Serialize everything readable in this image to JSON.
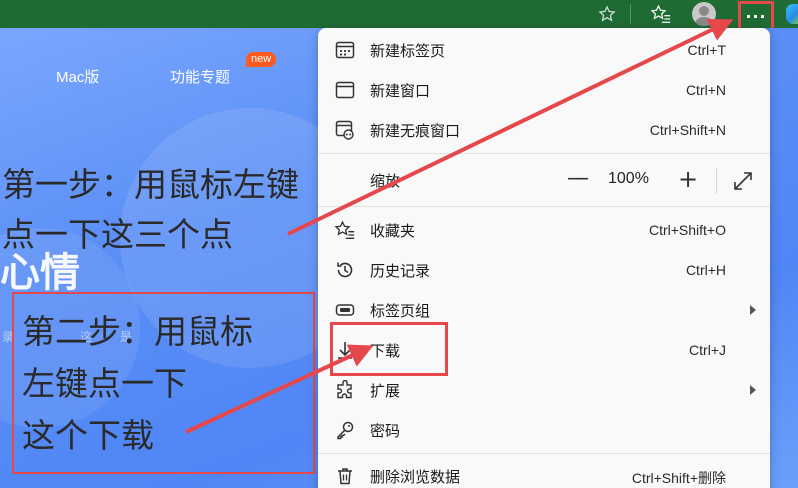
{
  "browser": {
    "favorite_icon": "star-outline-icon",
    "favorites_icon": "favorites-list-icon",
    "profile_icon": "avatar",
    "more_label": "···"
  },
  "page": {
    "nav_mac": "Mac版",
    "nav_features": "功能专题",
    "badge_new": "new",
    "hero_partial": "心情",
    "faint_left": "录",
    "faint_mid": "这",
    "faint_right": "是"
  },
  "annotations": {
    "step1_line1": "第一步：用鼠标左键",
    "step1_line2": "点一下这三个点",
    "step2_line1": "第二步：用鼠标",
    "step2_line2": "左键点一下",
    "step2_line3": "这个下载",
    "color": "#e5474b"
  },
  "menu": {
    "items": [
      {
        "label": "新建标签页",
        "shortcut": "Ctrl+T",
        "icon": "new-tab-icon"
      },
      {
        "label": "新建窗口",
        "shortcut": "Ctrl+N",
        "icon": "new-window-icon"
      },
      {
        "label": "新建无痕窗口",
        "shortcut": "Ctrl+Shift+N",
        "icon": "inprivate-window-icon"
      },
      {
        "label": "缩放",
        "icon": "zoom-icon"
      },
      {
        "label": "收藏夹",
        "shortcut": "Ctrl+Shift+O",
        "icon": "favorites-icon"
      },
      {
        "label": "历史记录",
        "shortcut": "Ctrl+H",
        "icon": "history-icon"
      },
      {
        "label": "标签页组",
        "icon": "tab-groups-icon"
      },
      {
        "label": "下载",
        "shortcut": "Ctrl+J",
        "icon": "download-icon"
      },
      {
        "label": "扩展",
        "icon": "extensions-icon"
      },
      {
        "label": "密码",
        "icon": "key-icon"
      },
      {
        "label": "删除浏览数据",
        "shortcut": "Ctrl+Shift+删除",
        "icon": "trash-icon"
      }
    ],
    "zoom": {
      "minus": "—",
      "value": "100%",
      "plus": "+"
    }
  }
}
